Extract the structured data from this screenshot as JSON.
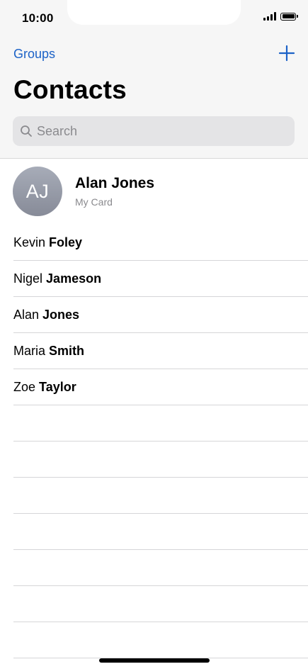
{
  "status_bar": {
    "time": "10:00",
    "signal_icon": "cellular-signal-icon",
    "battery_icon": "battery-full-icon"
  },
  "nav": {
    "groups_label": "Groups",
    "add_icon": "plus-icon"
  },
  "page": {
    "title": "Contacts"
  },
  "search": {
    "placeholder": "Search",
    "icon": "search-icon"
  },
  "my_card": {
    "initials": "AJ",
    "name": "Alan Jones",
    "subtitle": "My Card"
  },
  "contacts": [
    {
      "first": "Kevin",
      "last": "Foley"
    },
    {
      "first": "Nigel",
      "last": "Jameson"
    },
    {
      "first": "Alan",
      "last": "Jones"
    },
    {
      "first": "Maria",
      "last": "Smith"
    },
    {
      "first": "Zoe",
      "last": "Taylor"
    }
  ],
  "colors": {
    "accent": "#1c62c7",
    "header_bg": "#f6f6f6",
    "search_bg": "#e4e4e6",
    "secondary_text": "#8a8a8e"
  }
}
